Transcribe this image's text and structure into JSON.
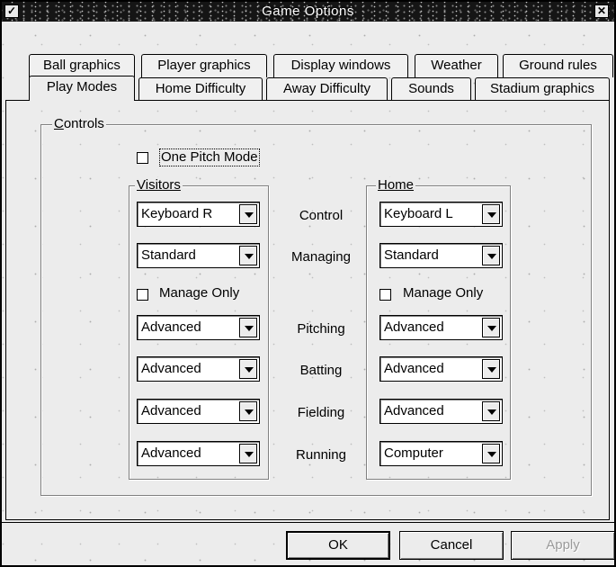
{
  "window": {
    "title": "Game Options"
  },
  "tabs_back": [
    "Ball graphics",
    "Player graphics",
    "Display windows",
    "Weather",
    "Ground rules"
  ],
  "tabs_front": [
    "Play Modes",
    "Home Difficulty",
    "Away Difficulty",
    "Sounds",
    "Stadium graphics"
  ],
  "active_tab": "Play Modes",
  "controls": {
    "legend": "Controls",
    "one_pitch_mode": {
      "label": "One Pitch Mode",
      "checked": false
    },
    "visitors": {
      "legend": "Visitors",
      "control": "Keyboard R",
      "managing": "Standard",
      "manage_only": {
        "label": "Manage Only",
        "checked": false
      },
      "pitching": "Advanced",
      "batting": "Advanced",
      "fielding": "Advanced",
      "running": "Advanced"
    },
    "home": {
      "legend": "Home",
      "control": "Keyboard L",
      "managing": "Standard",
      "manage_only": {
        "label": "Manage Only",
        "checked": false
      },
      "pitching": "Advanced",
      "batting": "Advanced",
      "fielding": "Advanced",
      "running": "Computer"
    },
    "row_labels": {
      "control": "Control",
      "managing": "Managing",
      "pitching": "Pitching",
      "batting": "Batting",
      "fielding": "Fielding",
      "running": "Running"
    }
  },
  "buttons": {
    "ok": "OK",
    "cancel": "Cancel",
    "apply": "Apply"
  },
  "icons": {
    "system_menu": "system-menu-icon",
    "close": "close-icon",
    "dropdown": "chevron-down-icon"
  }
}
